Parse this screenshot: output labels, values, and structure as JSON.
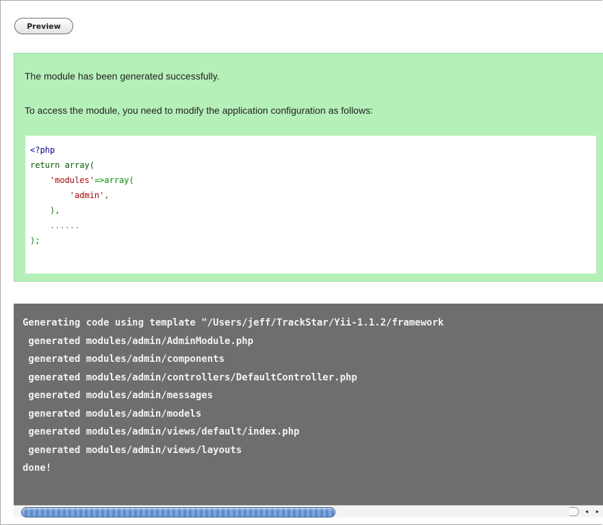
{
  "toolbar": {
    "preview_label": "Preview"
  },
  "success": {
    "message": "The module has been generated successfully.",
    "instructions": "To access the module, you need to modify the application configuration as follows:",
    "code": {
      "line1": "<?php",
      "line2_kw": "return array(",
      "line3_indent": "    ",
      "line3_str": "'modules'",
      "line3_op": "=>array(",
      "line4_indent": "        ",
      "line4_str": "'admin'",
      "line4_tail": ",",
      "line5": "    ),",
      "line6": "    ......",
      "line7": ");"
    }
  },
  "terminal": {
    "lines": [
      "Generating code using template \"/Users/jeff/TrackStar/Yii-1.1.2/framework",
      " generated modules/admin/AdminModule.php",
      " generated modules/admin/components",
      " generated modules/admin/controllers/DefaultController.php",
      " generated modules/admin/messages",
      " generated modules/admin/models",
      " generated modules/admin/views/default/index.php",
      " generated modules/admin/views/layouts",
      "done!"
    ]
  },
  "scrollbar": {
    "left_arrow": "◂",
    "right_arrow": "▸",
    "thumb_fraction": 0.53
  },
  "colors": {
    "success_bg": "#b6f0b9",
    "terminal_bg": "#6e6e6e",
    "code_string": "#cc0000",
    "code_tag": "#0000cc"
  }
}
